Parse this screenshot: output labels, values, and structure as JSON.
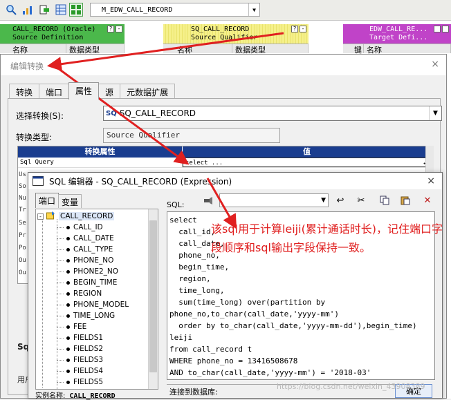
{
  "toolbar": {
    "mapping_combo_value": "M_EDW_CALL_RECORD",
    "icons": [
      "search-icon",
      "chart-icon",
      "export-icon",
      "grid-icon",
      "layout-icon"
    ]
  },
  "canvas": {
    "transforms": [
      {
        "title_line1": "CALL_RECORD (Oracle)",
        "title_line2": "Source Definition",
        "col1": "名称",
        "col2": "数据类型",
        "color": "#4bb84b"
      },
      {
        "title_line1": "SQ_CALL_RECORD",
        "title_line2": "Source Qualifier",
        "col1": "名称",
        "col2": "数据类型",
        "color": "#f5f08a"
      },
      {
        "title_line1": "EDW_CALL_RE...",
        "title_line2": "Target Defi...",
        "col1": "键",
        "col2": "名称",
        "color": "#c043c8"
      }
    ],
    "left_partial_labels": [
      "Us",
      "So",
      "Nu",
      "Tr",
      "Se",
      "Pr",
      "Po",
      "Ou",
      "Ou"
    ],
    "left_bottom_labels": [
      "Sq",
      "用户"
    ]
  },
  "edit_dialog": {
    "title": "编辑转换",
    "close": "×",
    "tabs": [
      "转换",
      "端口",
      "属性",
      "源",
      "元数据扩展"
    ],
    "active_tab": "属性",
    "select_label": "选择转换(S):",
    "select_value": "SQ_CALL_RECORD",
    "select_prefix": "SQ",
    "type_label": "转换类型:",
    "type_value": "Source Qualifier",
    "grid_header_attr": "转换属性",
    "grid_header_value": "值",
    "row1_attr": "Sql Query",
    "row1_value": "select ..."
  },
  "sql_editor": {
    "title": "SQL 编辑器 - SQ_CALL_RECORD (Expression)",
    "close": "×",
    "tabs": [
      "端口",
      "变量"
    ],
    "active_tab": "端口",
    "sql_label": "SQL:",
    "tree_root": "CALL_RECORD",
    "tree_items": [
      "CALL_ID",
      "CALL_DATE",
      "CALL_TYPE",
      "PHONE_NO",
      "PHONE2_NO",
      "BEGIN_TIME",
      "REGION",
      "PHONE_MODEL",
      "TIME_LONG",
      "FEE",
      "FIELDS1",
      "FIELDS2",
      "FIELDS3",
      "FIELDS4",
      "FIELDS5"
    ],
    "instance_label": "实例名称:",
    "instance_value": "CALL_RECORD",
    "sql_text": "select\n  call_id,\n  call_date,\n  phone_no,\n  begin_time,\n  region,\n  time_long,\n  sum(time_long) over(partition by phone_no,to_char(call_date,'yyyy-mm')\n  order by to_char(call_date,'yyyy-mm-dd'),begin_time) leiji\nfrom call_record t\nWHERE phone_no = 13416508678\nAND to_char(call_date,'yyyy-mm') = '2018-03'",
    "db_label": "连接到数据库:",
    "ok_label": "确定"
  },
  "annotation": {
    "text": "该sql用于计算leiji(累计通话时长)，记住端口字段顺序和sql输出字段保持一致。",
    "color": "#e02020"
  },
  "watermark": "https://blog.csdn.net/weixin_43908389"
}
